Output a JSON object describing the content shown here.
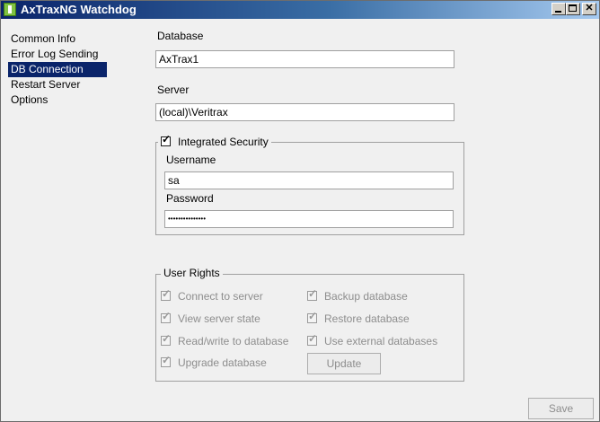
{
  "window": {
    "title": "AxTraxNG Watchdog"
  },
  "nav": {
    "items": [
      {
        "label": "Common Info"
      },
      {
        "label": "Error Log Sending"
      },
      {
        "label": "DB Connection"
      },
      {
        "label": "Restart Server"
      },
      {
        "label": "Options"
      }
    ],
    "selected": "DB Connection"
  },
  "db": {
    "database_label": "Database",
    "database_value": "AxTrax1",
    "server_label": "Server",
    "server_value": "(local)\\Veritrax"
  },
  "security": {
    "group_label": "Integrated Security",
    "checked": true,
    "username_label": "Username",
    "username_value": "sa",
    "password_label": "Password",
    "password_value": "•••••••••••••••"
  },
  "rights": {
    "group_label": "User Rights",
    "items": [
      {
        "label": "Connect to server",
        "checked": true
      },
      {
        "label": "View server state",
        "checked": true
      },
      {
        "label": "Read/write to database",
        "checked": true
      },
      {
        "label": "Upgrade database",
        "checked": true
      },
      {
        "label": "Backup database",
        "checked": true
      },
      {
        "label": "Restore database",
        "checked": true
      },
      {
        "label": "Use external databases",
        "checked": true
      }
    ],
    "update_label": "Update"
  },
  "footer": {
    "save_label": "Save"
  }
}
